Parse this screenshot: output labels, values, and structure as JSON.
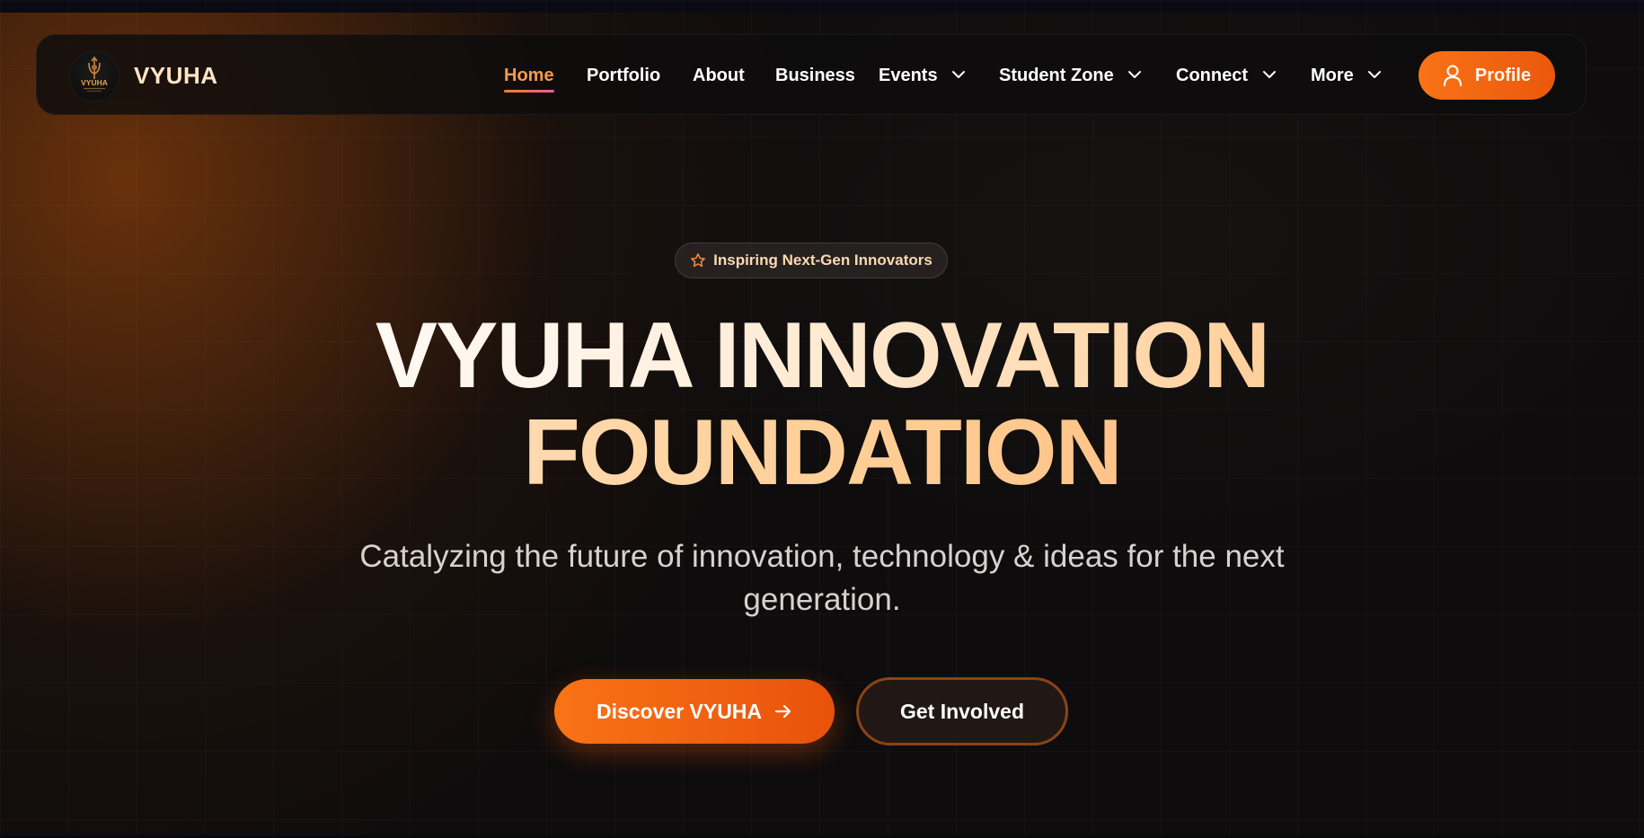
{
  "brand": {
    "name": "VYUHA",
    "logo_text": "VYUHA",
    "logo_icon": "trident-logo-icon"
  },
  "nav": {
    "items": [
      {
        "label": "Home",
        "active": true,
        "dropdown": false
      },
      {
        "label": "Portfolio",
        "active": false,
        "dropdown": false
      },
      {
        "label": "About",
        "active": false,
        "dropdown": false
      },
      {
        "label": "Business",
        "active": false,
        "dropdown": false
      },
      {
        "label": "Events",
        "active": false,
        "dropdown": true
      },
      {
        "label": "Student Zone",
        "active": false,
        "dropdown": true
      },
      {
        "label": "Connect",
        "active": false,
        "dropdown": true
      },
      {
        "label": "More",
        "active": false,
        "dropdown": true
      }
    ],
    "profile_label": "Profile",
    "profile_icon": "user-icon"
  },
  "hero": {
    "badge": "Inspiring Next-Gen Innovators",
    "badge_icon": "star-icon",
    "title_line1": "VYUHA INNOVATION",
    "title_line2": "FOUNDATION",
    "subtitle": "Catalyzing the future of innovation, technology & ideas for the next generation.",
    "primary_cta": "Discover VYUHA",
    "primary_cta_icon": "arrow-right-icon",
    "secondary_cta": "Get Involved"
  },
  "colors": {
    "accent": "#f97316",
    "accent_dark": "#ea580c",
    "active_nav": "#f99a4c",
    "badge_text": "#fcd9b0",
    "background": "#0e0c0d",
    "secondary_border": "#8a4317"
  }
}
